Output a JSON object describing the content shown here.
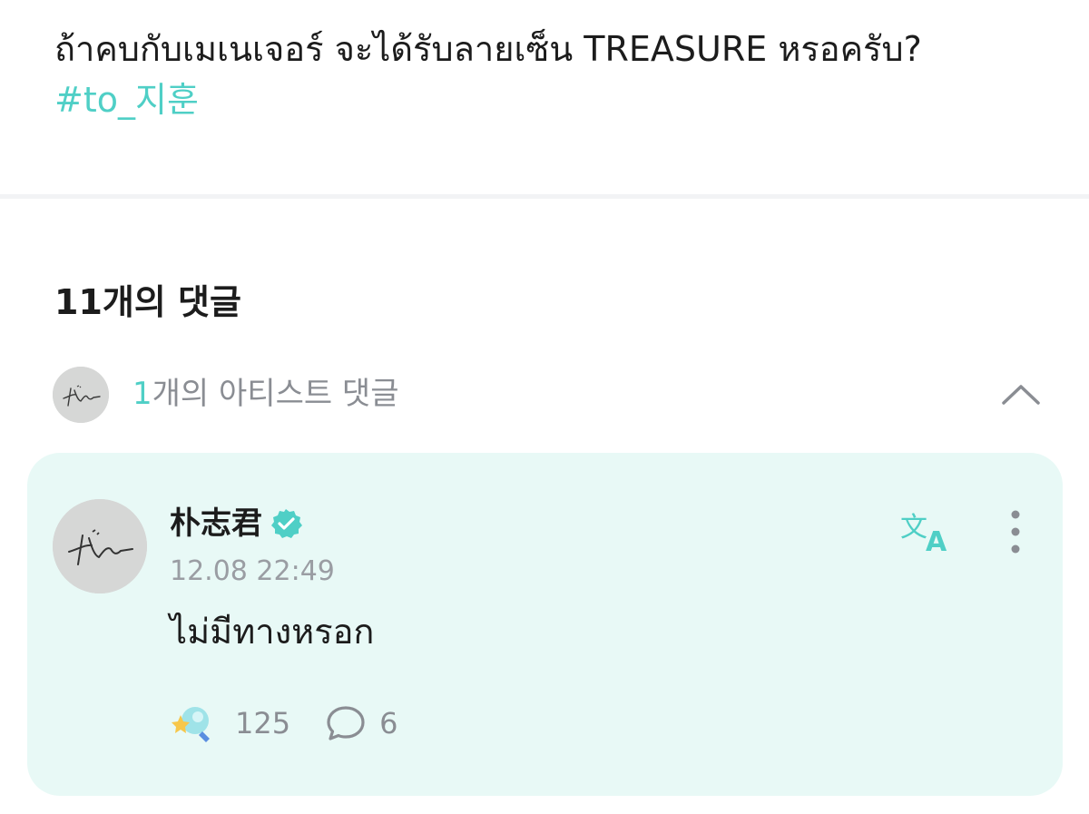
{
  "post": {
    "text": "ถ้าคบกับเมเนเจอร์ จะได้รับลายเซ็น TREASURE หรอครับ?",
    "tag": "#to_지훈"
  },
  "comments": {
    "title": "11개의 댓글",
    "artist_comments": {
      "count": "1",
      "label": "개의 아티스트 댓글",
      "toggle_icon": "chevron-up-icon"
    }
  },
  "artist_comment": {
    "author": "朴志君",
    "timestamp": "12.08 22:49",
    "body": "ไม่มีทางหรอก",
    "likes": "125",
    "replies": "6",
    "icons": {
      "verified": "verified-badge-icon",
      "translate": "translate-icon",
      "more": "more-vertical-icon",
      "reaction": "reaction-icon",
      "reply": "comment-bubble-icon"
    }
  },
  "colors": {
    "accent": "#4fcfc6",
    "card_background": "#e8f9f6",
    "muted_text": "#8a8d93"
  }
}
